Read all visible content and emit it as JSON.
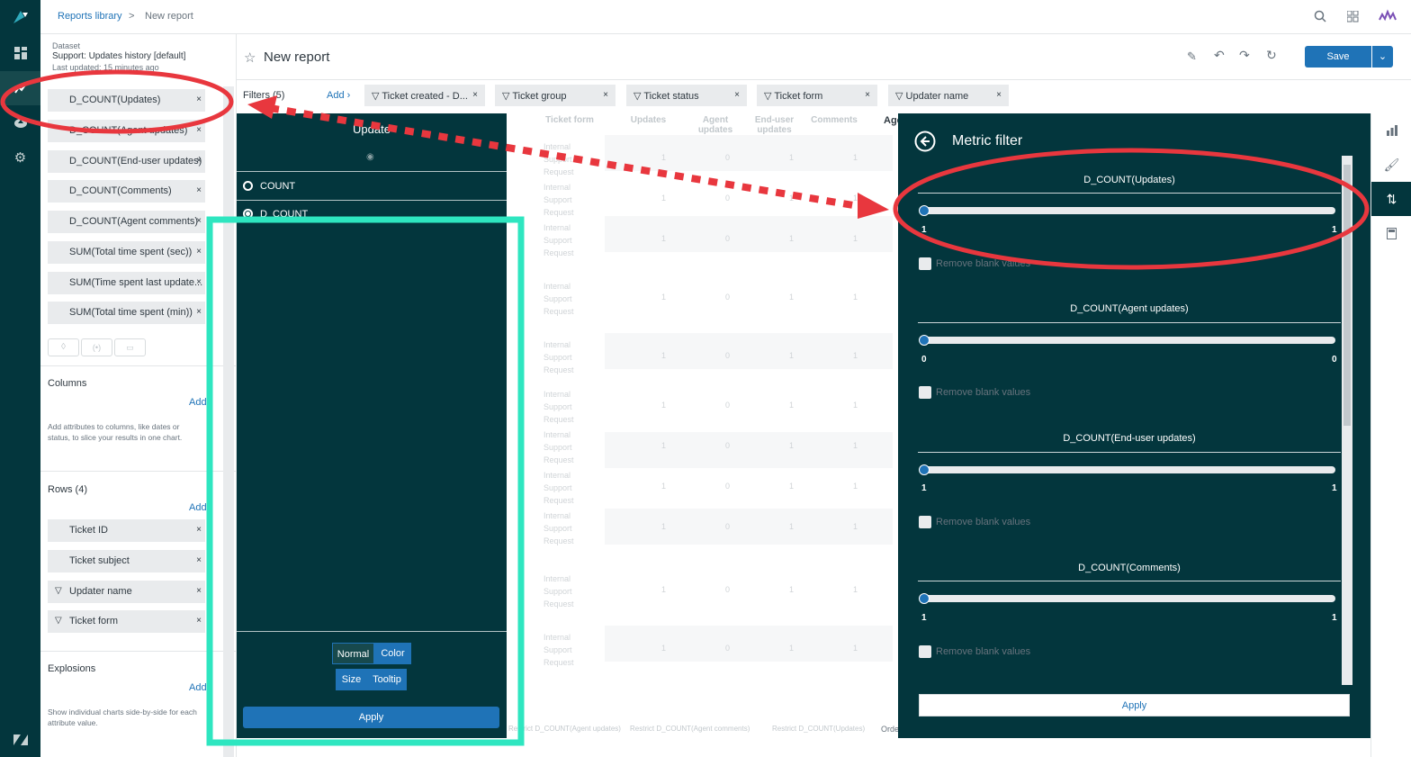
{
  "breadcrumb": {
    "parent": "Reports library",
    "separator": ">",
    "current": "New report"
  },
  "report": {
    "title": "New report",
    "save_label": "Save"
  },
  "dataset": {
    "label": "Dataset",
    "name": "Support: Updates history [default]",
    "updated": "Last updated: 15 minutes ago"
  },
  "metrics": [
    "D_COUNT(Updates)",
    "D_COUNT(Agent updates)",
    "D_COUNT(End-user updates)",
    "D_COUNT(Comments)",
    "D_COUNT(Agent comments)",
    "SUM(Total time spent (sec))",
    "SUM(Time spent last update...",
    "SUM(Total time spent (min))"
  ],
  "columns": {
    "title": "Columns",
    "add": "Add",
    "desc": "Add attributes to columns, like dates or status, to slice your results in one chart."
  },
  "rows": {
    "title": "Rows (4)",
    "add": "Add",
    "items": [
      "Ticket ID",
      "Ticket subject",
      "Updater name",
      "Ticket form"
    ]
  },
  "explosions": {
    "title": "Explosions",
    "add": "Add",
    "desc": "Show individual charts side-by-side for each attribute value."
  },
  "filters": {
    "label": "Filters (5)",
    "add": "Add ›",
    "items": [
      "Ticket created - D...",
      "Ticket group",
      "Ticket status",
      "Ticket form",
      "Updater name"
    ]
  },
  "picker": {
    "title": "Update",
    "options": [
      "COUNT",
      "D_COUNT"
    ],
    "mode_buttons": [
      "Normal",
      "Color",
      "Size",
      "Tooltip"
    ],
    "apply": "Apply"
  },
  "table": {
    "headers": [
      "Ticket form",
      "Updates",
      "Agent updates",
      "End-user updates",
      "Comments",
      "Age"
    ],
    "row_label": "Internal Support Request",
    "rows": [
      [
        "1",
        "0",
        "1",
        "1"
      ],
      [
        "1",
        "0",
        "1",
        "1"
      ],
      [
        "1",
        "0",
        "1",
        "1"
      ],
      [
        "1",
        "0",
        "1",
        "1"
      ],
      [
        "1",
        "0",
        "1",
        "1"
      ],
      [
        "1",
        "0",
        "1",
        "1"
      ],
      [
        "1",
        "0",
        "1",
        "1"
      ],
      [
        "1",
        "0",
        "1",
        "1"
      ],
      [
        "1",
        "0",
        "1",
        "1"
      ],
      [
        "1",
        "0",
        "1",
        "1"
      ],
      [
        "1",
        "0",
        "1",
        "1"
      ]
    ],
    "footer_links": [
      "Restrict D_COUNT(Agent updates)",
      "Restrict D_COUNT(Agent comments)",
      "Restrict D_COUNT(Updates)"
    ],
    "footer_order": "Order"
  },
  "metric_filter": {
    "title": "Metric filter",
    "remove_blank": "Remove blank values",
    "apply": "Apply",
    "items": [
      {
        "name": "D_COUNT(Updates)",
        "min": "1",
        "max": "1"
      },
      {
        "name": "D_COUNT(Agent updates)",
        "min": "0",
        "max": "0"
      },
      {
        "name": "D_COUNT(End-user updates)",
        "min": "1",
        "max": "1"
      },
      {
        "name": "D_COUNT(Comments)",
        "min": "1",
        "max": "1"
      }
    ]
  },
  "colors": {
    "dark_panel": "#03363d",
    "accent_blue": "#1f73b7",
    "annotation_red": "#e8373e",
    "annotation_teal": "#2ee6c0"
  }
}
